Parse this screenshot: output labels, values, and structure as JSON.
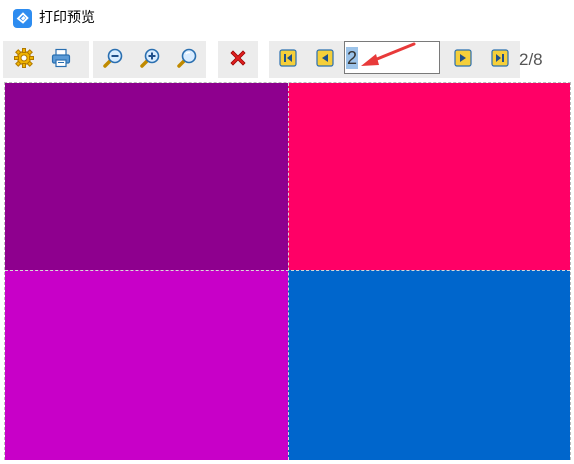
{
  "window": {
    "title": "打印预览"
  },
  "toolbar": {
    "buttons": [
      {
        "name": "settings",
        "icon": "gear-icon"
      },
      {
        "name": "print",
        "icon": "printer-icon"
      },
      {
        "name": "zoom-out",
        "icon": "zoom-out-icon"
      },
      {
        "name": "zoom-in",
        "icon": "zoom-in-icon"
      },
      {
        "name": "zoom-fit",
        "icon": "magnifier-icon"
      },
      {
        "name": "close",
        "icon": "close-icon"
      },
      {
        "name": "first-page",
        "icon": "first-page-icon"
      },
      {
        "name": "prev-page",
        "icon": "prev-page-icon"
      },
      {
        "name": "next-page",
        "icon": "next-page-icon"
      },
      {
        "name": "last-page",
        "icon": "last-page-icon"
      }
    ],
    "page_input_value": "2",
    "page_count": "2/8"
  },
  "preview": {
    "cells": [
      {
        "position": "top-left",
        "color": "#8e008e"
      },
      {
        "position": "top-right",
        "color": "#ff0066"
      },
      {
        "position": "bottom-left",
        "color": "#c800c8"
      },
      {
        "position": "bottom-right",
        "color": "#0066cc"
      }
    ]
  },
  "annotation": {
    "arrow_color": "#e83a3a"
  }
}
